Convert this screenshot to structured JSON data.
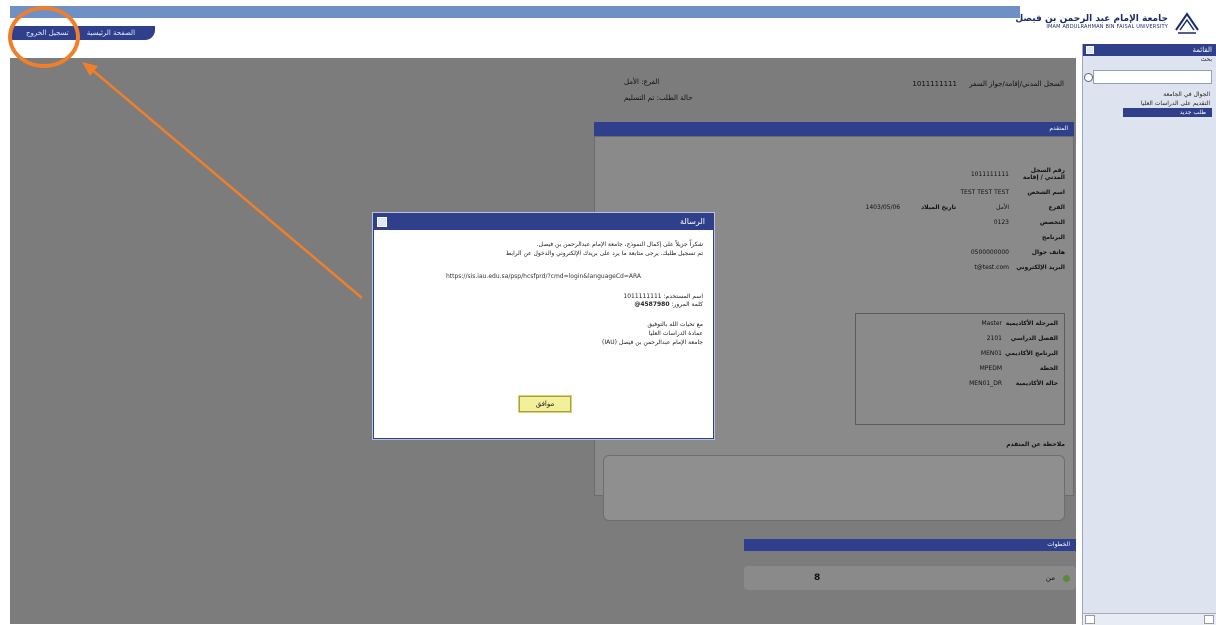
{
  "header": {
    "nav_tabs": [
      "الصفحة الرئيسية",
      "تسجيل الخروج"
    ],
    "logo_ar": "جامعة الإمام عبد الرحمن بن فيصل",
    "logo_en": "IMAM ABDULRAHMAN BIN FAISAL UNIVERSITY"
  },
  "sidebar": {
    "title": "القائمة",
    "subtitle": "بحث",
    "items": [
      "الجوال في الجامعة",
      "التقديم على الدراسات العليا",
      "طلب جديد"
    ]
  },
  "background_form": {
    "field1": "السجل المدني/إقامة/جواز السفر",
    "field1_value": "1011111111",
    "field2": "الفرع: الأمل",
    "field3": "حالة الطلب: تم التسليم",
    "section_title": "المتقدم",
    "rows": [
      {
        "label": "رقم السجل المدني / إقامة",
        "value": "1011111111"
      },
      {
        "label": "اسم الشخص",
        "value": "TEST TEST TEST"
      },
      {
        "label": "الفرع",
        "value": "الأمل"
      },
      {
        "label": "تاريخ الميلاد",
        "value": "1403/05/06"
      },
      {
        "label": "التخصص",
        "value": "0123"
      },
      {
        "label": "البرنامج",
        "value": ""
      },
      {
        "label": "هاتف جوال",
        "value": "0500000000"
      },
      {
        "label": "البريد الإلكتروني",
        "value": "t@test.com"
      }
    ],
    "acad_rows": [
      {
        "label": "المرحلة الأكاديمية",
        "value": "Master"
      },
      {
        "label": "الفصل الدراسي",
        "value": "2101"
      },
      {
        "label": "البرنامج الأكاديمي",
        "value": "MEN01"
      },
      {
        "label": "الخطة",
        "value": "MPEDM"
      },
      {
        "label": "حالة الأكاديمية",
        "value": "MEN01_DR"
      }
    ],
    "notes_label": "ملاحظة عن المتقدم",
    "status_bar": "الخطوات",
    "pager_text": "من",
    "pager_count": "8"
  },
  "dialog": {
    "title": "الرسالة",
    "line1": "شكراً جزيلاً على إكمال النموذج، جامعة الإمام عبدالرحمن بن فيصل.",
    "line2": "تم تسجيل طلبك. يرجى متابعة ما يرد على بريدك الإلكتروني والدخول عن الرابط",
    "url": "https://sis.iau.edu.sa/psp/hcsfprd/?cmd=login&languageCd=ARA",
    "username_label": "اسم المستخدم:",
    "username": "1011111111",
    "password_label": "كلمة المرور:",
    "password": "4587980@",
    "closing1": "مع تحيات الله بالتوفيق",
    "closing2": "عمادة الدراسات العليا",
    "closing3": "جامعة الإمام عبدالرحمن بن فيصل (IAU)",
    "ok_label": "موافق"
  },
  "colors": {
    "navy": "#2f3f8c",
    "annotation": "#ef7f2a"
  }
}
